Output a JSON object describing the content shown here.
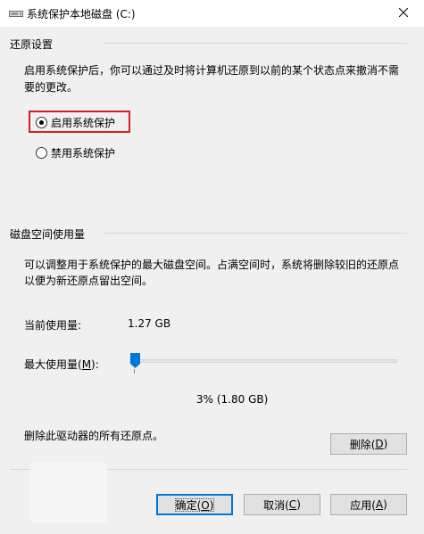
{
  "window": {
    "title": "系统保护本地磁盘 (C:)"
  },
  "restore": {
    "heading": "还原设置",
    "description_line1": "启用系统保护后，你可以通过及时将计算机还原到以前的某个状态点来撤消不需",
    "description_line2": "要的更改。",
    "options": [
      {
        "label": "启用系统保护",
        "selected": true
      },
      {
        "label": "禁用系统保护",
        "selected": false
      }
    ]
  },
  "disk_usage": {
    "heading": "磁盘空间使用量",
    "description_line1": "可以调整用于系统保护的最大磁盘空间。占满空间时，系统将删除较旧的还原点",
    "description_line2": "以便为新还原点留出空间。",
    "current_label": "当前使用量:",
    "current_value": "1.27 GB",
    "max_label_prefix": "最大使用量(",
    "max_label_key": "M",
    "max_label_suffix": "):",
    "slider_percent": 3,
    "slider_value_text": "3% (1.80 GB)"
  },
  "delete_section": {
    "text": "删除此驱动器的所有还原点。",
    "button_prefix": "删除(",
    "button_key": "D",
    "button_suffix": ")"
  },
  "footer": {
    "ok_prefix": "确定(",
    "ok_key": "O",
    "ok_suffix": ")",
    "cancel_prefix": "取消(",
    "cancel_key": "C",
    "cancel_suffix": ")",
    "apply_prefix": "应用(",
    "apply_key": "A",
    "apply_suffix": ")"
  },
  "colors": {
    "highlight": "#d12128",
    "accent": "#0078d7",
    "slider_thumb": "#0078d7"
  },
  "icons": {
    "title": "drive-icon",
    "close": "close-icon",
    "slider_thumb": "slider-thumb-icon"
  }
}
